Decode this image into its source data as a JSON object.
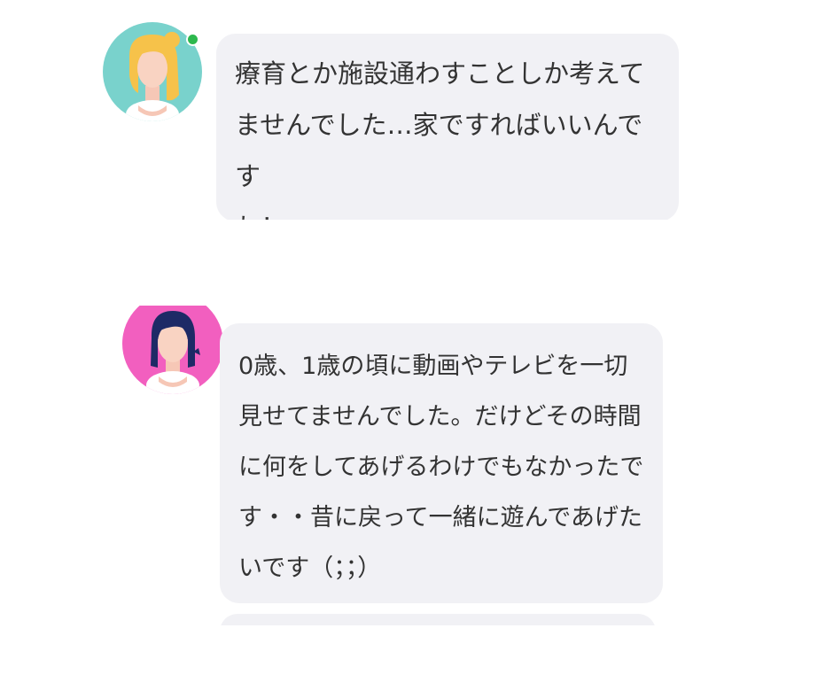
{
  "messages": [
    {
      "sender_name": "",
      "time": "",
      "avatar_icon": "woman-yellow-hair-avatar-icon",
      "avatar_bg": "#79d2cc",
      "online": true,
      "lines": [
        "療育とか施設通わすことしか考えて",
        "ませんでした…家ですればいいんです",
        "ね！"
      ]
    },
    {
      "sender_name": "",
      "time": "",
      "avatar_icon": "woman-dark-hair-avatar-icon",
      "avatar_bg": "#f25fbf",
      "online": false,
      "lines": [
        "0歳、1歳の頃に動画やテレビを一切",
        "見せてませんでした。だけどその時間",
        "に何をしてあげるわけでもなかったで",
        "す・・昔に戻って一緒に遊んであげた",
        "いです（；；）"
      ]
    }
  ],
  "colors": {
    "bubble": "#f1f1f5",
    "text": "#333333",
    "name_link": "#1c6fd1",
    "online_dot": "#2db84d"
  }
}
